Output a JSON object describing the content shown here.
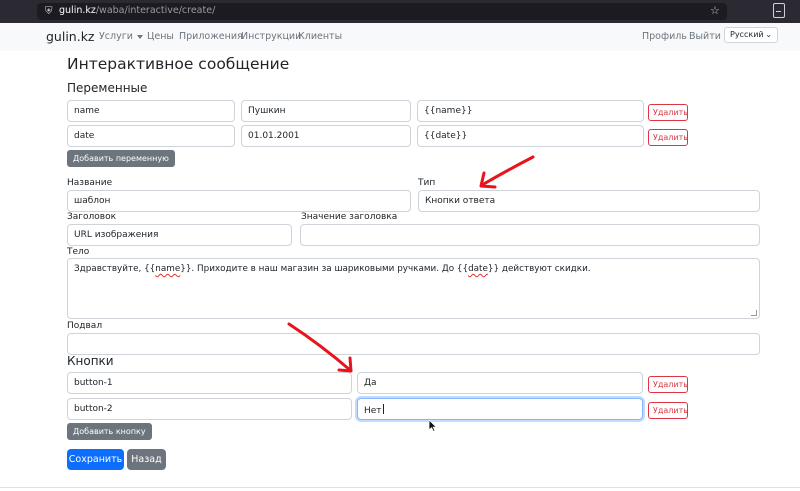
{
  "browser": {
    "url_host": "gulin.kz",
    "url_path": "/waba/interactive/create/"
  },
  "navbar": {
    "brand": "gulin.kz",
    "links": [
      "Услуги",
      "Цены",
      "Приложения",
      "Инструкции",
      "Клиенты"
    ],
    "profile": "Профиль",
    "logout": "Выйти",
    "language": "Русский"
  },
  "page": {
    "title": "Интерактивное сообщение"
  },
  "variables": {
    "heading": "Переменные",
    "rows": [
      {
        "name": "name",
        "value": "Пушкин",
        "placeholder": "{{name}}",
        "delete": "Удалить"
      },
      {
        "name": "date",
        "value": "01.01.2001",
        "placeholder": "{{date}}",
        "delete": "Удалить"
      }
    ],
    "add_button": "Добавить переменную"
  },
  "form": {
    "name_label": "Название",
    "name_value": "шаблон",
    "type_label": "Тип",
    "type_value": "Кнопки ответа",
    "header_label": "Заголовок",
    "header_value": "URL изображения",
    "header_value_label": "Значение заголовка",
    "header_value_value": "",
    "body_label": "Тело",
    "body_parts": [
      "Здравствуйте, {{",
      "name",
      "}}. Приходите в наш магазин за шариковыми ручками. До {{",
      "date",
      "}} действуют скидки."
    ],
    "footer_label": "Подвал",
    "footer_value": ""
  },
  "buttons_section": {
    "heading": "Кнопки",
    "rows": [
      {
        "id": "button-1",
        "text": "Да",
        "delete": "Удалить"
      },
      {
        "id": "button-2",
        "text": "Нет",
        "delete": "Удалить"
      }
    ],
    "add_button": "Добавить кнопку"
  },
  "actions": {
    "save": "Сохранить",
    "back": "Назад"
  },
  "colors": {
    "primary": "#0d6efd",
    "secondary": "#6c757d",
    "danger": "#dc3545",
    "annotation_arrow": "#e8131b"
  }
}
